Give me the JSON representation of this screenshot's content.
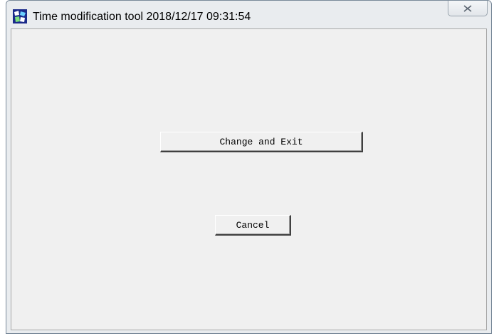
{
  "window": {
    "title": "Time modification tool 2018/12/17 09:31:54",
    "app_icon": "app-icon",
    "close_icon": "close-icon"
  },
  "buttons": {
    "change_and_exit": "Change and Exit",
    "cancel": "Cancel"
  }
}
